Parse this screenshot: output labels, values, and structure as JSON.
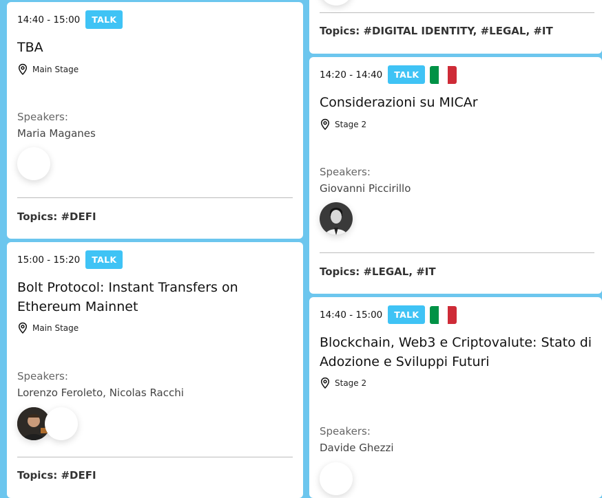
{
  "cards": [
    {
      "time": "14:40 - 15:00",
      "badge": "TALK",
      "title": "TBA",
      "location": "Main Stage",
      "speakers_label": "Speakers:",
      "speakers": "Maria Maganes",
      "topics": "Topics: #DEFI"
    },
    {
      "time": "15:00 - 15:20",
      "badge": "TALK",
      "title": "Bolt Protocol: Instant Transfers on Ethereum Mainnet",
      "location": "Main Stage",
      "speakers_label": "Speakers:",
      "speakers": "Lorenzo Feroleto, Nicolas Racchi",
      "topics": "Topics: #DEFI"
    },
    {
      "topics": "Topics: #DIGITAL IDENTITY, #LEGAL, #IT"
    },
    {
      "time": "14:20 - 14:40",
      "badge": "TALK",
      "flag": "italy-flag",
      "title": "Considerazioni su MICAr",
      "location": "Stage 2",
      "speakers_label": "Speakers:",
      "speakers": "Giovanni Piccirillo",
      "topics": "Topics: #LEGAL, #IT"
    },
    {
      "time": "14:40 - 15:00",
      "badge": "TALK",
      "flag": "italy-flag",
      "title": "Blockchain, Web3 e Criptovalute: Stato di Adozione e Sviluppi Futuri",
      "location": "Stage 2",
      "speakers_label": "Speakers:",
      "speakers": "Davide Ghezzi"
    }
  ],
  "colors": {
    "background": "#6cc6ee",
    "badge": "#3fc3f5",
    "flag_green": "#009246",
    "flag_white": "#ffffff",
    "flag_red": "#ce2b37"
  }
}
